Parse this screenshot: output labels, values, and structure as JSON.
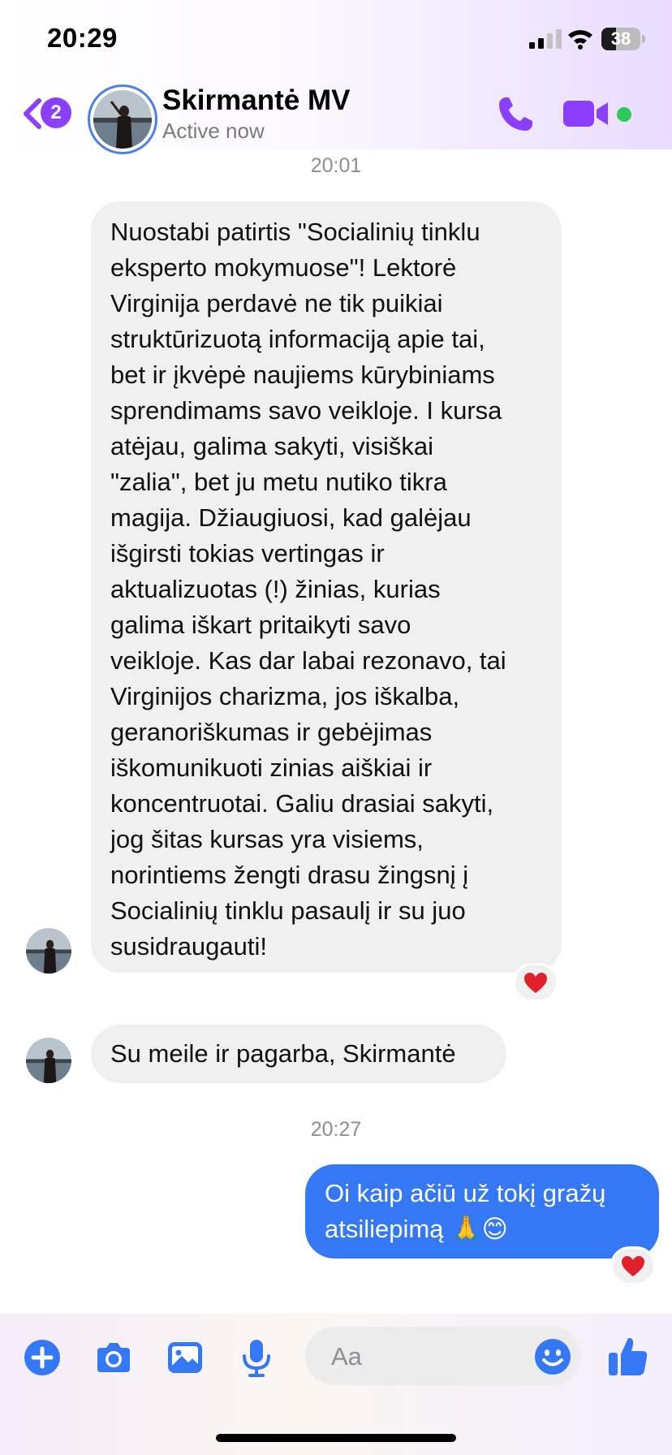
{
  "status_bar": {
    "time": "20:29",
    "battery_percent": 38,
    "battery_level": 0.38
  },
  "header": {
    "unread_count": "2",
    "contact_name": "Skirmantė MV",
    "contact_status": "Active now",
    "icons": [
      "back-chevron-icon",
      "phone-icon",
      "video-camera-icon"
    ],
    "accent_color": "#8a3ffc",
    "online_color": "#30c85a"
  },
  "chat": {
    "timestamp_1": "20:01",
    "message_1_lines": [
      "Nuostabi patirtis \"Socialinių tinklu",
      "eksperto mokymuose\"! Lektorė",
      "Virginija perdavė ne tik puikiai",
      "struktūrizuotą informaciją apie tai,",
      "bet ir įkvėpė naujiems kūrybiniams",
      "sprendimams savo veikloje. I kursa",
      "atėjau, galima sakyti, visiškai",
      "\"zalia\", bet ju metu nutiko tikra",
      "magija. Džiaugiuosi, kad galėjau",
      "išgirsti tokias vertingas ir",
      "aktualizuotas (!) žinias, kurias",
      "galima iškart pritaikyti savo",
      "veikloje. Kas dar labai rezonavo, tai",
      "Virginijos charizma, jos iškalba,",
      "geranoriškumas ir gebėjimas",
      "iškomunikuoti zinias aiškiai ir",
      "koncentruotai. Galiu drasiai sakyti,",
      "jog šitas kursas yra visiems,",
      "norintiems žengti drasu žingsnį į",
      "Socialinių tinklu pasaulį ir su juo",
      "susidraugauti!"
    ],
    "message_2": "Su meile ir pagarba, Skirmantė",
    "timestamp_2": "20:27",
    "message_3_lines": [
      "Oi kaip ačiū už tokį gražų",
      "atsiliepimą 🙏😊"
    ],
    "reaction": "heart-icon",
    "incoming_bubble_color": "#f0f0f0",
    "outgoing_bubble_color": "#3478f6"
  },
  "composer": {
    "placeholder": "Aa",
    "icons": [
      "plus-icon",
      "camera-icon",
      "gallery-icon",
      "microphone-icon",
      "emoji-icon",
      "thumbs-up-icon"
    ],
    "icon_color": "#3478f6"
  }
}
